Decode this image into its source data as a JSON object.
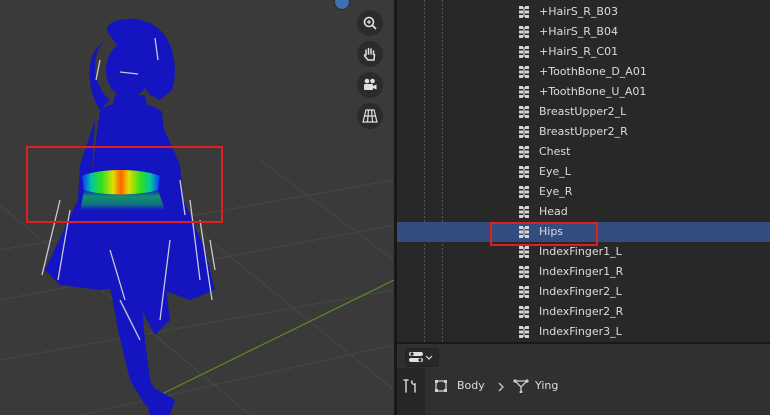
{
  "outliner": {
    "items": [
      {
        "label": "+HairS_R_B03",
        "selected": false
      },
      {
        "label": "+HairS_R_B04",
        "selected": false
      },
      {
        "label": "+HairS_R_C01",
        "selected": false
      },
      {
        "label": "+ToothBone_D_A01",
        "selected": false
      },
      {
        "label": "+ToothBone_U_A01",
        "selected": false
      },
      {
        "label": "BreastUpper2_L",
        "selected": false
      },
      {
        "label": "BreastUpper2_R",
        "selected": false
      },
      {
        "label": "Chest",
        "selected": false
      },
      {
        "label": "Eye_L",
        "selected": false
      },
      {
        "label": "Eye_R",
        "selected": false
      },
      {
        "label": "Head",
        "selected": false
      },
      {
        "label": "Hips",
        "selected": true
      },
      {
        "label": "IndexFinger1_L",
        "selected": false
      },
      {
        "label": "IndexFinger1_R",
        "selected": false
      },
      {
        "label": "IndexFinger2_L",
        "selected": false
      },
      {
        "label": "IndexFinger2_R",
        "selected": false
      },
      {
        "label": "IndexFinger3_L",
        "selected": false
      }
    ]
  },
  "properties": {
    "breadcrumb": {
      "object": "Body",
      "modifier": "Ying"
    }
  },
  "viewport_tools": [
    {
      "name": "zoom-icon"
    },
    {
      "name": "hand-pan-icon"
    },
    {
      "name": "camera-icon"
    },
    {
      "name": "grid-perspective-icon"
    }
  ],
  "colors": {
    "selection": "#334d80",
    "highlight_annotation": "#e02020",
    "mesh_weight_zero": "#1010c8"
  }
}
